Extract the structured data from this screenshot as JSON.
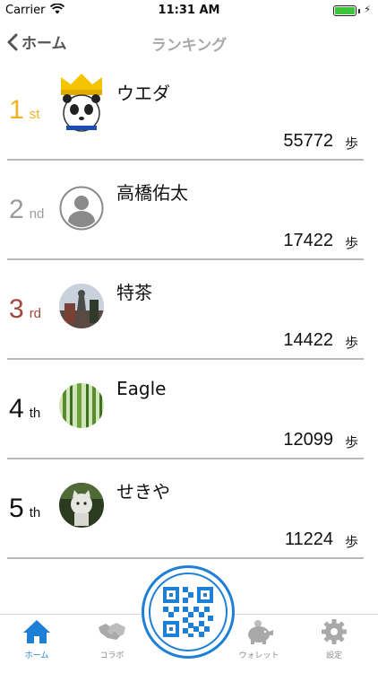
{
  "status_bar": {
    "carrier": "Carrier",
    "time": "11:31 AM"
  },
  "nav": {
    "back_label": "ホーム",
    "title": "ランキング"
  },
  "colors": {
    "accent": "#1e7fd6",
    "gold": "#f0b323",
    "silver": "#9b9b9b",
    "bronze": "#a0473a",
    "default_rank": "#111111"
  },
  "ranking": [
    {
      "rank": "1",
      "suffix": "st",
      "name": "ウエダ",
      "steps": "55772",
      "unit": "歩",
      "avatar": "panda-king-avatar"
    },
    {
      "rank": "2",
      "suffix": "nd",
      "name": "高橋佑太",
      "steps": "17422",
      "unit": "歩",
      "avatar": "default-person-avatar"
    },
    {
      "rank": "3",
      "suffix": "rd",
      "name": "特茶",
      "steps": "14422",
      "unit": "歩",
      "avatar": "statue-photo-avatar"
    },
    {
      "rank": "4",
      "suffix": "th",
      "name": "Eagle",
      "steps": "12099",
      "unit": "歩",
      "avatar": "bamboo-photo-avatar"
    },
    {
      "rank": "5",
      "suffix": "th",
      "name": "せきや",
      "steps": "11224",
      "unit": "歩",
      "avatar": "cat-figure-avatar"
    }
  ],
  "tabs": [
    {
      "label": "ホーム",
      "icon": "home-icon",
      "active": true
    },
    {
      "label": "コラボ",
      "icon": "handshake-icon",
      "active": false
    },
    {
      "label": "ウォレット",
      "icon": "piggy-bank-icon",
      "active": false
    },
    {
      "label": "設定",
      "icon": "gear-icon",
      "active": false
    }
  ],
  "center_button": {
    "icon": "qr-code-icon"
  }
}
